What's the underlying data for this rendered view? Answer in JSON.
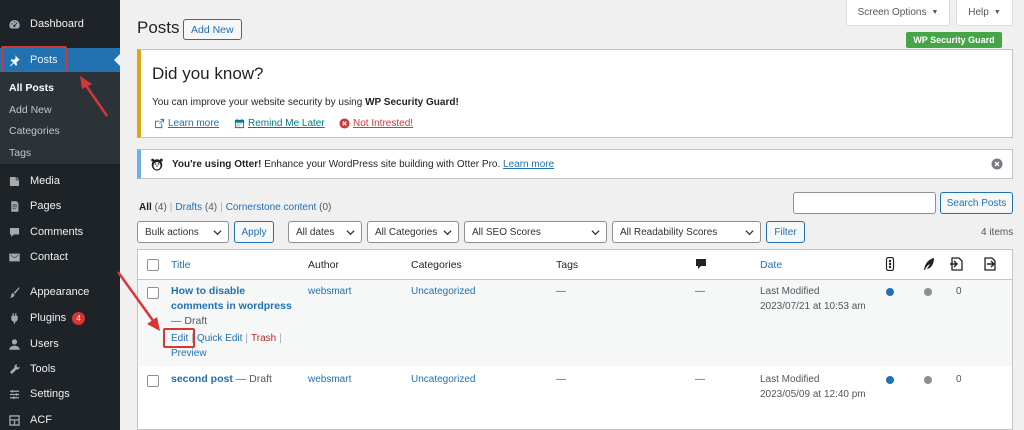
{
  "colors": {
    "sidebar_bg": "#1d2327",
    "accent": "#2271b1",
    "highlight_red": "#d63638",
    "seo_dot_blue": "#2271b1",
    "readability_dot_gray": "#8c8f94",
    "wpsg_green": "#46a546"
  },
  "sidebar": {
    "items": [
      {
        "label": "Dashboard",
        "icon": "dashboard-icon"
      },
      {
        "label": "Posts",
        "icon": "pin-icon"
      },
      {
        "label": "Media",
        "icon": "media-icon"
      },
      {
        "label": "Pages",
        "icon": "pages-icon"
      },
      {
        "label": "Comments",
        "icon": "comments-icon"
      },
      {
        "label": "Contact",
        "icon": "mail-icon"
      },
      {
        "label": "Appearance",
        "icon": "brush-icon"
      },
      {
        "label": "Plugins",
        "icon": "plugin-icon",
        "badge": "4"
      },
      {
        "label": "Users",
        "icon": "users-icon"
      },
      {
        "label": "Tools",
        "icon": "wrench-icon"
      },
      {
        "label": "Settings",
        "icon": "settings-icon"
      },
      {
        "label": "ACF",
        "icon": "acf-icon"
      }
    ],
    "submenu": [
      "All Posts",
      "Add New",
      "Categories",
      "Tags"
    ]
  },
  "screen_options": {
    "label": "Screen Options",
    "help_label": "Help"
  },
  "wpsg_badge": "WP Security Guard",
  "header": {
    "title": "Posts",
    "add_new": "Add New"
  },
  "did_you_know": {
    "title": "Did you know?",
    "text_prefix": "You can improve your website security by using ",
    "text_bold": "WP Security Guard!",
    "learn_more": "Learn more",
    "remind_later": "Remind Me Later",
    "not_interested": "Not Intrested!"
  },
  "otter_notice": {
    "text_bold": "You're using Otter!",
    "text": " Enhance your WordPress site building with Otter Pro. ",
    "link": "Learn more"
  },
  "views": {
    "all": "All",
    "all_count": "(4)",
    "drafts": "Drafts",
    "drafts_count": "(4)",
    "cornerstone": "Cornerstone content",
    "cornerstone_count": "(0)"
  },
  "search": {
    "value": "",
    "button": "Search Posts"
  },
  "filters": {
    "bulk_actions": "Bulk actions",
    "apply": "Apply",
    "dates": "All dates",
    "categories": "All Categories",
    "seo": "All SEO Scores",
    "readability": "All Readability Scores",
    "filter": "Filter",
    "items_count": "4 items"
  },
  "table": {
    "headers": {
      "title": "Title",
      "author": "Author",
      "categories": "Categories",
      "tags": "Tags",
      "date": "Date"
    },
    "rows": [
      {
        "title_line1": "How to disable",
        "title_line2": "comments in wordpress",
        "state": "— Draft",
        "actions": {
          "edit": "Edit",
          "quick_edit": "Quick Edit",
          "trash": "Trash",
          "preview": "Preview"
        },
        "author": "websmart",
        "category": "Uncategorized",
        "tags": "—",
        "comments": "—",
        "date_status": "Last Modified",
        "date": "2023/07/21 at 10:53 am",
        "links": "0"
      },
      {
        "title": "second post",
        "state": "— Draft",
        "author": "websmart",
        "category": "Uncategorized",
        "tags": "—",
        "comments": "—",
        "date_status": "Last Modified",
        "date": "2023/05/09 at 12:40 pm",
        "links": "0"
      }
    ]
  }
}
